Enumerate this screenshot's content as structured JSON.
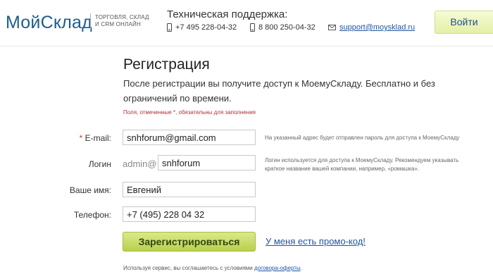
{
  "header": {
    "logo": "МойСклад",
    "tagline": [
      "ТОРГОВЛЯ, СКЛАД",
      "И CRM ОНЛАЙН"
    ],
    "support_title": "Техническая поддержка:",
    "phone1": "+7 495 228-04-32",
    "phone2": "8 800 250-04-32",
    "email": "support@moysklad.ru",
    "login_button": "Войти"
  },
  "form": {
    "title": "Регистрация",
    "intro": "После регистрации вы получите доступ к МоемуСкладу. Бесплатно и без ограничений по времени.",
    "required_note": "Поля, отмеченные *, обязательны для заполнения",
    "email": {
      "star": "*",
      "label": "E-mail:",
      "value": "snhforum@gmail.com",
      "hint": "На указанный адрес будет отправлен пароль для доступа к МоемуСкладу"
    },
    "login": {
      "label": "Логин",
      "prefix": "admin@",
      "value": "snhforum",
      "hint": "Логин используется для доступа к МоемуСкладу. Рекомендуем указывать краткое название вашей компании, например, «ромашка»."
    },
    "name": {
      "label": "Ваше имя:",
      "value": "Евгений"
    },
    "phone": {
      "label": "Телефон:",
      "value": "+7 (495) 228 04 32"
    },
    "register_button": "Зарегистрироваться",
    "promo_link": "У меня есть промо-код!",
    "terms_text": "Используя сервис, вы соглашаетесь с условиями",
    "terms_link": "договора-оферты",
    "terms_end": "."
  },
  "colors": {
    "brand": "#1d5c8e",
    "link": "#1f55a0",
    "required": "#b03030",
    "button_green": "#b9d04c"
  }
}
